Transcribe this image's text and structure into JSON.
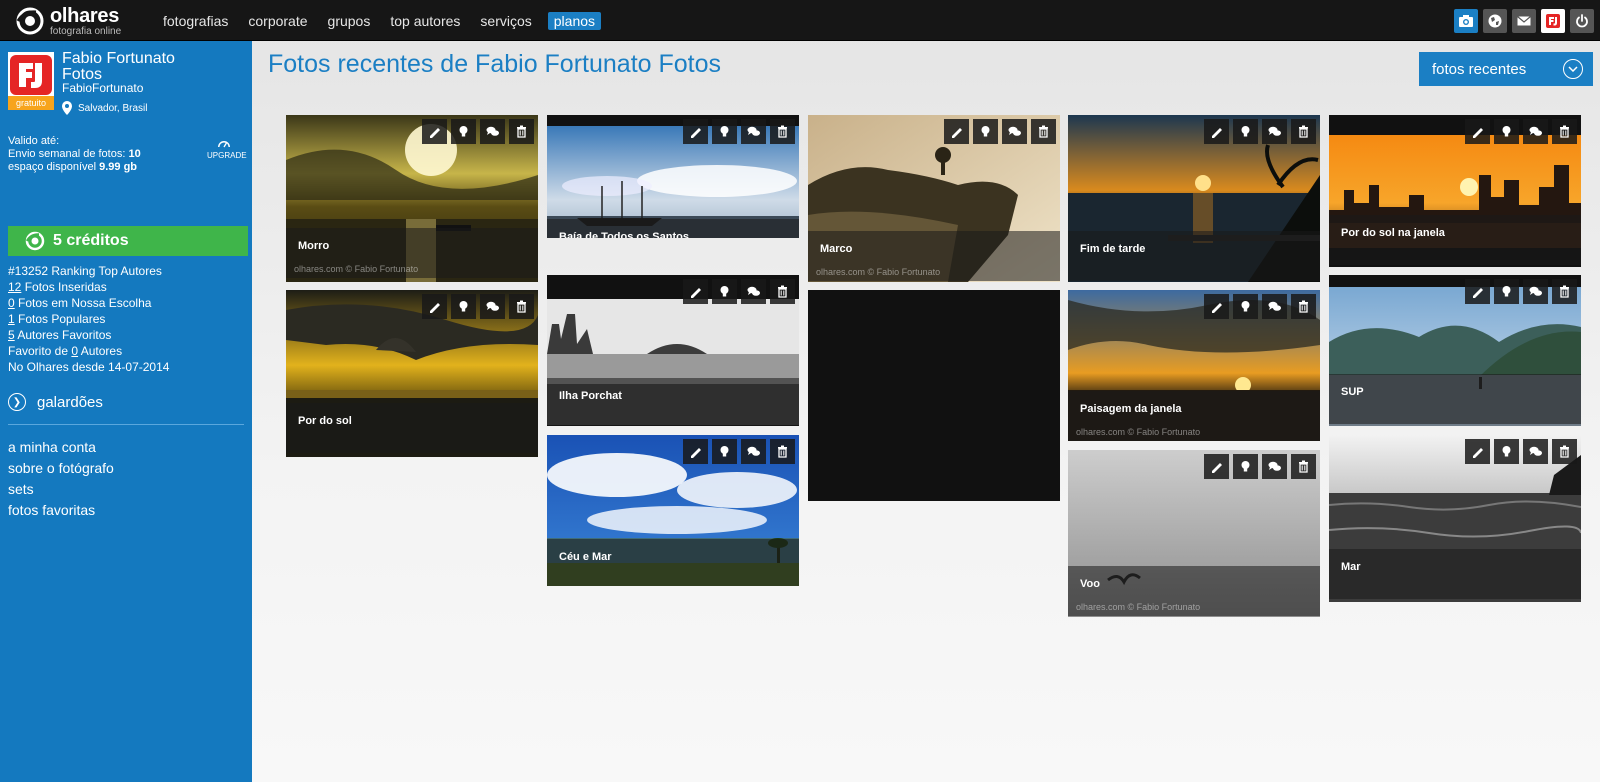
{
  "app": {
    "logo_name": "olhares",
    "logo_tagline": "fotografia online"
  },
  "nav": {
    "items": [
      {
        "label": "fotografias"
      },
      {
        "label": "corporate"
      },
      {
        "label": "grupos"
      },
      {
        "label": "top autores"
      },
      {
        "label": "serviços"
      },
      {
        "label": "planos"
      }
    ]
  },
  "top_icons": [
    {
      "icon": "camera-icon",
      "color": "#1b7fc4"
    },
    {
      "icon": "globe-icon",
      "color": "#555555"
    },
    {
      "icon": "mail-icon",
      "color": "#555555"
    },
    {
      "icon": "user-avatar-icon",
      "color": "#ffffff"
    },
    {
      "icon": "power-icon",
      "color": "#555555"
    }
  ],
  "profile": {
    "name_line1": "Fabio Fortunato",
    "name_line2": "Fotos",
    "username": "FabioFortunato",
    "location": "Salvador, Brasil",
    "plan_badge": "gratuito",
    "valid_label": "Valido até:",
    "weekly_label": "Envio semanal de fotos:",
    "weekly_value": "10",
    "space_label": "espaço disponível",
    "space_value": "9.99 gb",
    "upgrade_label": "UPGRADE",
    "credits_label": "5 créditos"
  },
  "stats": [
    {
      "num": "",
      "text": "#13252 Ranking Top Autores"
    },
    {
      "num": "12",
      "text": " Fotos Inseridas"
    },
    {
      "num": "0",
      "text": " Fotos em Nossa Escolha"
    },
    {
      "num": "1",
      "text": " Fotos Populares"
    },
    {
      "num": "5",
      "text": " Autores Favoritos"
    },
    {
      "pre": "Favorito de ",
      "num": "0",
      "text": " Autores"
    },
    {
      "num": "",
      "text": "No Olhares desde 14-07-2014"
    }
  ],
  "galardoes_label": "galardões",
  "side_links": [
    {
      "label": "a minha conta"
    },
    {
      "label": "sobre o fotógrafo"
    },
    {
      "label": "sets"
    },
    {
      "label": "fotos favoritas"
    }
  ],
  "main": {
    "title": "Fotos recentes de Fabio Fortunato Fotos",
    "sort_label": "fotos recentes"
  },
  "watermark": "olhares.com © Fabio Fortunato",
  "photos": [
    {
      "caption": "Morro",
      "scene": "sunset-gold"
    },
    {
      "caption": "Por do sol",
      "scene": "storm-gold"
    },
    {
      "caption": "Baía de Todos os Santos",
      "scene": "ship"
    },
    {
      "caption": "Ilha Porchat",
      "scene": "bw-city"
    },
    {
      "caption": "Céu e Mar",
      "scene": "blue-sky"
    },
    {
      "caption": "Marco",
      "scene": "rock-sepia"
    },
    {
      "caption": "",
      "scene": "empty"
    },
    {
      "caption": "Fim de tarde",
      "scene": "pier-sunset"
    },
    {
      "caption": "Paisagem da janela",
      "scene": "window-sunset"
    },
    {
      "caption": "Voo",
      "scene": "grey-bird"
    },
    {
      "caption": "Por do sol na janela",
      "scene": "orange-city"
    },
    {
      "caption": "SUP",
      "scene": "mountains"
    },
    {
      "caption": "Mar",
      "scene": "bw-sea"
    }
  ]
}
